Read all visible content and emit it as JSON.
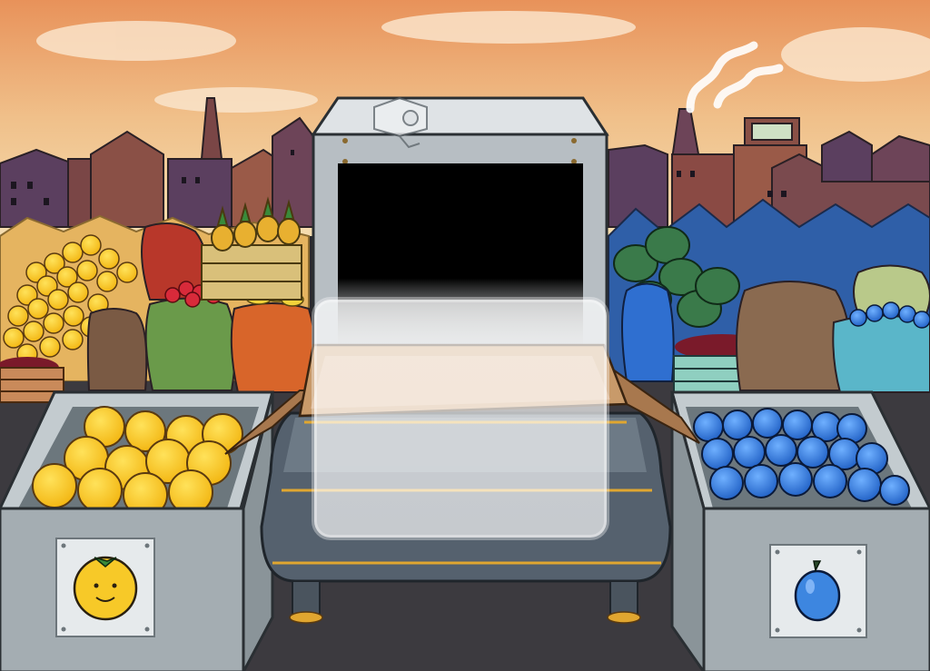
{
  "scene": {
    "left_bin": {
      "fruit": "orange",
      "label_icon": "smiling-orange-icon"
    },
    "right_bin": {
      "fruit": "plum",
      "label_icon": "plum-icon"
    },
    "scanner": {
      "camera_icon": "security-camera-icon",
      "screen": "dark"
    },
    "conveyor": {
      "item": "cardboard-box"
    }
  },
  "colors": {
    "sky_top": "#e9a25e",
    "sky_bottom": "#f2d39a",
    "bin_gray": "#9aa3a8",
    "orange": "#f7c928",
    "plum": "#3d86e0",
    "scanner_frame": "#b7bec3",
    "belt": "#55616e",
    "box": "#b98a5b"
  }
}
